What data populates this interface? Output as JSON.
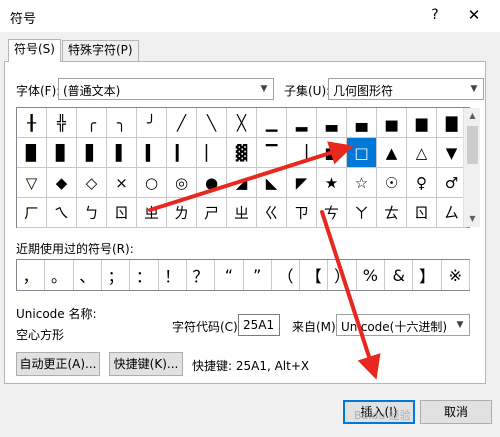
{
  "dialog": {
    "title": "符号",
    "help_label": "?",
    "close_label": "✕"
  },
  "tabs": [
    {
      "label": "符号(S)",
      "active": true
    },
    {
      "label": "特殊字符(P)",
      "active": false
    }
  ],
  "font": {
    "label": "字体(F):",
    "value": "(普通文本)"
  },
  "subset": {
    "label": "子集(U):",
    "value": "几何图形符"
  },
  "symbol_rows": [
    [
      "╂",
      "╬",
      "╭",
      "╮",
      "╯",
      "╱",
      "╲",
      "╳",
      "▁",
      "▂",
      "▃",
      "▄",
      "▅",
      "▆",
      "▇"
    ],
    [
      "▉",
      "▊",
      "▋",
      "▌",
      "▍",
      "▎",
      "▏",
      "▓",
      "▔",
      "▕",
      "■",
      "□",
      "▲",
      "△",
      "▼"
    ],
    [
      "▽",
      "◆",
      "◇",
      "×",
      "○",
      "◎",
      "●",
      "◢",
      "◣",
      "◤",
      "★",
      "☆",
      "☉",
      "♀",
      "♂"
    ],
    [
      "ㄏ",
      "ㄟ",
      "ㄅ",
      "ㄖ",
      "ㄓ",
      "ㄌ",
      "ㄕ",
      "ㄓ",
      "ㄍ",
      "ㄗ",
      "ㄘ",
      "ㄚ",
      "ㄊ",
      "ㄖ",
      "ㄙ"
    ]
  ],
  "selected_symbol": {
    "row": 1,
    "col": 11
  },
  "recent": {
    "label": "近期使用过的符号(R):",
    "symbols": [
      "，",
      "。",
      "、",
      "；",
      "：",
      "！",
      "？",
      "“",
      "”",
      "（",
      "【",
      "）",
      "%",
      "&",
      "】",
      "※"
    ]
  },
  "unicode_name": {
    "label": "Unicode 名称:",
    "value": "空心方形"
  },
  "char_code": {
    "label": "字符代码(C):",
    "value": "25A1"
  },
  "from": {
    "label": "来自(M):",
    "value": "Unicode(十六进制)"
  },
  "buttons": {
    "autocorrect": "自动更正(A)...",
    "shortcut_key": "快捷键(K)...",
    "insert": "插入(I)",
    "cancel": "取消"
  },
  "shortcut_info": "快捷键: 25A1, Alt+X",
  "annotation_color": "#e8281e",
  "accent_color": "#0078d7"
}
